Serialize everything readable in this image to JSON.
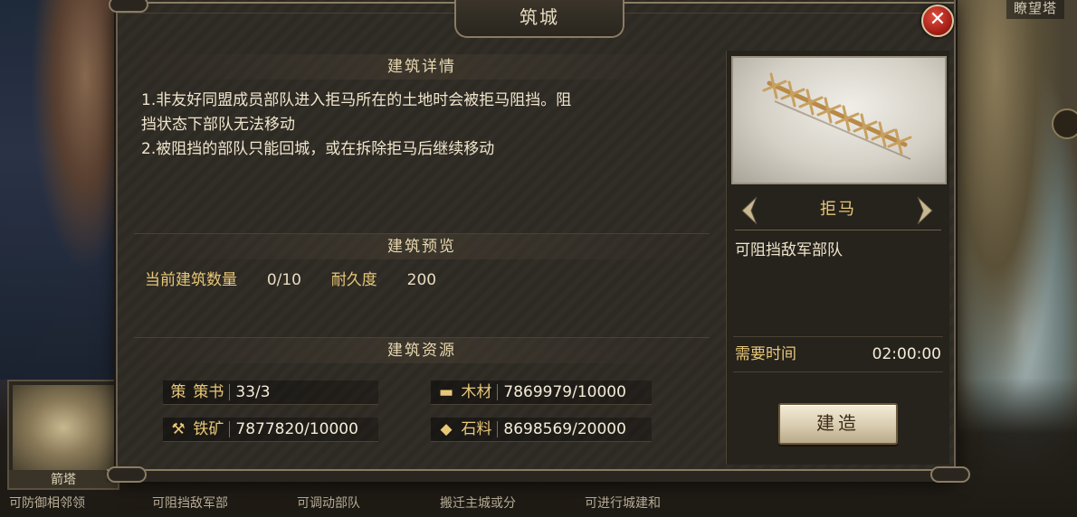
{
  "background": {
    "top_right_label": "瞭望塔",
    "bottom_cards": [
      {
        "name": "箭塔",
        "desc": "可防御相邻领"
      },
      {
        "name": "",
        "desc": "可阻挡敌军部"
      },
      {
        "name": "",
        "desc": "可调动部队"
      },
      {
        "name": "",
        "desc": "搬迁主城或分"
      },
      {
        "name": "",
        "desc": "可进行城建和"
      }
    ]
  },
  "dialog": {
    "title": "筑城",
    "close_symbol": "✕"
  },
  "details": {
    "heading": "建筑详情",
    "lines": [
      "1.非友好同盟成员部队进入拒马所在的土地时会被拒马阻挡。阻",
      "挡状态下部队无法移动",
      "2.被阻挡的部队只能回城，或在拆除拒马后继续移动"
    ]
  },
  "preview": {
    "heading": "建筑预览",
    "count_label": "当前建筑数量",
    "count_value": "0/10",
    "durability_label": "耐久度",
    "durability_value": "200"
  },
  "resources": {
    "heading": "建筑资源",
    "items": [
      {
        "icon": "策",
        "name": "策书",
        "value": "33/3"
      },
      {
        "icon": "▬",
        "name": "木材",
        "value": "7869979/10000"
      },
      {
        "icon": "⚒",
        "name": "铁矿",
        "value": "7877820/10000"
      },
      {
        "icon": "◆",
        "name": "石料",
        "value": "8698569/20000"
      }
    ]
  },
  "building": {
    "name": "拒马",
    "description": "可阻挡敌军部队",
    "time_label": "需要时间",
    "time_value": "02:00:00",
    "build_button": "建造"
  },
  "colors": {
    "accent_gold": "#e8c878",
    "panel_bg": "#2e2a24",
    "close_red": "#a82018"
  }
}
